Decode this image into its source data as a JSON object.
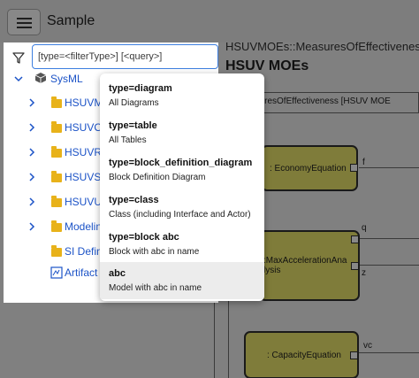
{
  "app": {
    "title": "Sample"
  },
  "diagram": {
    "path": "HSUVMOEs::MeasuresOfEffectiveness",
    "title": "HSUV MOEs",
    "frame_label": "ock] MeasuresOfEffectiveness [HSUV MOE",
    "blocks": [
      {
        "label": ": EconomyEquation",
        "ports": [
          "f"
        ]
      },
      {
        "label_line1": ":MaxAccelerationAna",
        "label_line2": "lysis",
        "ports": [
          "q",
          "z"
        ]
      },
      {
        "label": ": CapacityEquation",
        "ports": [
          "vc"
        ]
      }
    ]
  },
  "tree": {
    "search": {
      "placeholder": "[type=<filterType>] [<query>]",
      "value": ""
    },
    "root": {
      "label": "SysML",
      "icon": "package-icon"
    },
    "items": [
      {
        "label": "HSUVM",
        "icon": "folder-icon"
      },
      {
        "label": "HSUVO",
        "icon": "folder-icon"
      },
      {
        "label": "HSUVR",
        "icon": "folder-icon"
      },
      {
        "label": "HSUVS",
        "icon": "folder-icon"
      },
      {
        "label": "HSUVU",
        "icon": "folder-icon"
      },
      {
        "label": "Modelin",
        "icon": "folder-icon"
      },
      {
        "label": "SI Defin",
        "icon": "folder-icon"
      },
      {
        "label": "Artifact",
        "icon": "artifact-icon"
      }
    ]
  },
  "dropdown": {
    "options": [
      {
        "title": "type=diagram",
        "desc": "All Diagrams"
      },
      {
        "title": "type=table",
        "desc": "All Tables"
      },
      {
        "title": "type=block_definition_diagram",
        "desc": "Block Definition Diagram"
      },
      {
        "title": "type=class",
        "desc": "Class (including Interface and Actor)"
      },
      {
        "title": "type=block abc",
        "desc": "Block with abc in name"
      },
      {
        "title": "abc",
        "desc": "Model with abc in name"
      }
    ],
    "active_index": 5
  },
  "colors": {
    "accent": "#3d7fe0",
    "link": "#1c53c7",
    "folder": "#e8b21a",
    "block_fill": "#7f7c3a"
  }
}
